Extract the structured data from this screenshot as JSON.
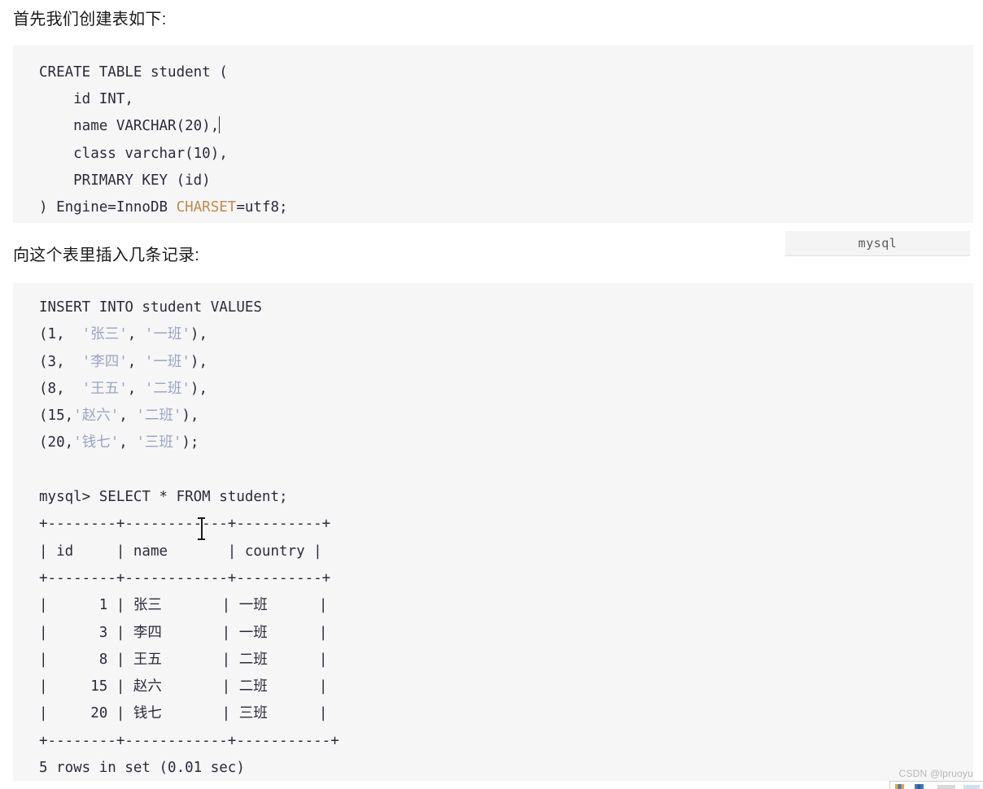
{
  "document": {
    "paragraph_1": "首先我们创建表如下:",
    "paragraph_2": "向这个表里插入几条记录:"
  },
  "colors": {
    "page_background": "#ffffff",
    "code_background": "#f6f6f6",
    "code_text": "#2b2b3a",
    "keyword_charset": "#c08a4a",
    "string_literal": "#9aa4c4",
    "label_background": "#f4f4f4",
    "label_text": "#5b5b5b",
    "watermark_text": "#b7b7b7"
  },
  "code_block_create": {
    "language_label": "mysql",
    "lines": [
      {
        "id": "l1",
        "text": "CREATE TABLE student ("
      },
      {
        "id": "l2",
        "text": "    id INT,"
      },
      {
        "id": "l3",
        "text": "    name VARCHAR(20),",
        "caret_after": true
      },
      {
        "id": "l4",
        "text": "    class varchar(10),"
      },
      {
        "id": "l5",
        "text": "    PRIMARY KEY (id)"
      },
      {
        "id": "l6_a",
        "text": ") Engine=InnoDB "
      },
      {
        "id": "l6_b",
        "text": "CHARSET"
      },
      {
        "id": "l6_c",
        "text": "=utf8;"
      }
    ]
  },
  "code_block_insert": {
    "header": "INSERT INTO student VALUES",
    "insert_rows": [
      {
        "prefix": "(1,  ",
        "name": "'张三'",
        "sep": ", ",
        "class": "'一班'",
        "suffix": "),"
      },
      {
        "prefix": "(3,  ",
        "name": "'李四'",
        "sep": ", ",
        "class": "'一班'",
        "suffix": "),"
      },
      {
        "prefix": "(8,  ",
        "name": "'王五'",
        "sep": ", ",
        "class": "'二班'",
        "suffix": "),"
      },
      {
        "prefix": "(15,",
        "name": "'赵六'",
        "sep": ", ",
        "class": "'二班'",
        "suffix": "),"
      },
      {
        "prefix": "(20,",
        "name": "'钱七'",
        "sep": ", ",
        "class": "'三班'",
        "suffix": ");"
      }
    ],
    "prompt_line": "mysql> SELECT * FROM student;",
    "table": {
      "rule_top": "+--------+------------+----------+",
      "header_row": "| id     | name       | country |",
      "rule_mid": "+--------+------------+----------+",
      "columns": [
        "id",
        "name",
        "country"
      ],
      "rows": [
        {
          "id": "1",
          "name": "张三",
          "country": "一班"
        },
        {
          "id": "3",
          "name": "李四",
          "country": "一班"
        },
        {
          "id": "8",
          "name": "王五",
          "country": "二班"
        },
        {
          "id": "15",
          "name": "赵六",
          "country": "二班"
        },
        {
          "id": "20",
          "name": "钱七",
          "country": "三班"
        }
      ],
      "rule_bottom": "+--------+------------+-----------+",
      "row_lines": [
        "|      1 | 张三       | 一班      |",
        "|      3 | 李四       | 一班      |",
        "|      8 | 王五       | 二班      |",
        "|     15 | 赵六       | 二班      |",
        "|     20 | 钱七       | 三班      |"
      ]
    },
    "result_footer": "5 rows in set (0.01 sec)"
  },
  "watermark": {
    "text": "CSDN @lpruoyu"
  }
}
